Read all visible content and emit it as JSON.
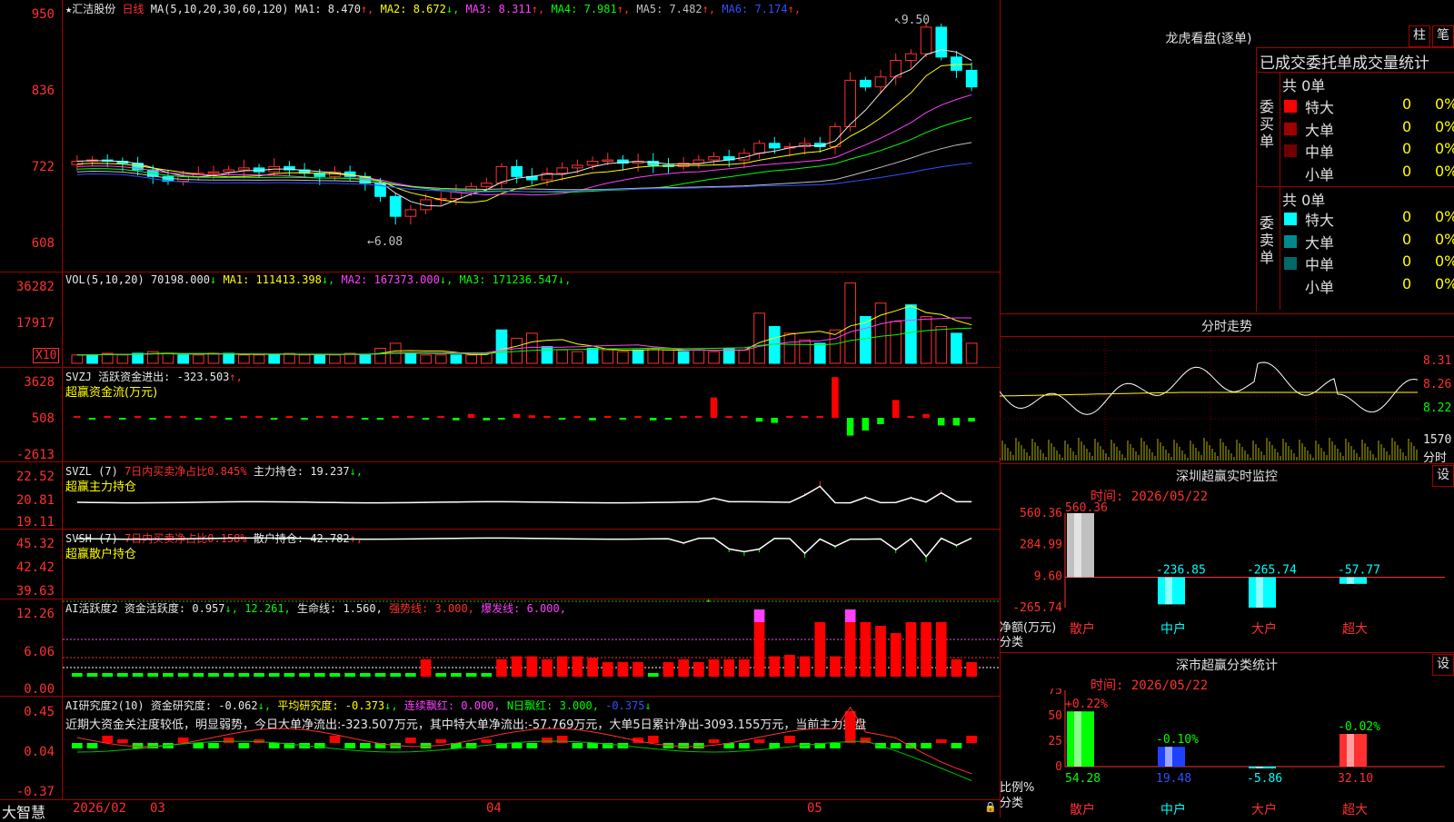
{
  "main_chart": {
    "symbol": "★汇洁股份",
    "period": "日线",
    "ma_header": "MA(5,10,20,30,60,120)",
    "ma": [
      {
        "label": "MA1:",
        "value": "8.470",
        "arrow": "↑",
        "color": "#e8e8e8"
      },
      {
        "label": "MA2:",
        "value": "8.672",
        "arrow": "↓",
        "color": "#ffff00"
      },
      {
        "label": "MA3:",
        "value": "8.311",
        "arrow": "↑",
        "color": "#ff40ff"
      },
      {
        "label": "MA4:",
        "value": "7.981",
        "arrow": "↑",
        "color": "#00ff00"
      },
      {
        "label": "MA5:",
        "value": "7.482",
        "arrow": "↑",
        "color": "#c0c0c0"
      },
      {
        "label": "MA6:",
        "value": "7.174",
        "arrow": "↑",
        "color": "#3050ff"
      }
    ],
    "y_ticks": [
      "950",
      "836",
      "722",
      "608"
    ],
    "high_annotation": "9.50",
    "low_annotation": "6.08",
    "ylim": [
      5.7,
      9.6
    ]
  },
  "volume": {
    "header": "VOL(5,10,20)",
    "value": "70198.000",
    "value_arrow": "↓",
    "ma": [
      {
        "label": "MA1:",
        "value": "111413.398",
        "arrow": "↓",
        "color": "#ffff00"
      },
      {
        "label": "MA2:",
        "value": "167373.000",
        "arrow": "↓",
        "color": "#ff40ff"
      },
      {
        "label": "MA3:",
        "value": "171236.547",
        "arrow": "↓",
        "color": "#00ff00"
      }
    ],
    "y_ticks": [
      "36282",
      "17917"
    ],
    "unit": "X10"
  },
  "svzj": {
    "header": "SVZJ",
    "label": "活跃资金进出:",
    "value": "-323.503",
    "arrow": "↑,",
    "subtitle": "超赢资金流(万元)",
    "y_ticks": [
      "3628",
      "508",
      "-2613"
    ]
  },
  "svzl": {
    "header": "SVZL (7)",
    "label1": "7日内买卖净占比0.845%",
    "label2": "主力持仓:",
    "value": "19.237",
    "arrow": "↓,",
    "subtitle": "超赢主力持仓",
    "y_ticks": [
      "22.52",
      "20.81",
      "19.11"
    ]
  },
  "svsh": {
    "header": "SVSH (7)",
    "label1": "7日内买卖净占比0.158%",
    "label2": "散户持仓:",
    "value": "42.782",
    "arrow": "↑,",
    "subtitle": "超赢散户持仓",
    "y_ticks": [
      "45.32",
      "42.42",
      "39.63"
    ]
  },
  "ai_active": {
    "header": "AI活跃度2",
    "label": "资金活跃度:",
    "value": "0.957",
    "arrow": "↓,",
    "v2": "12.261,",
    "life_label": "生命线:",
    "life_value": "1.560,",
    "strong_label": "强势线:",
    "strong_value": "3.000,",
    "burst_label": "爆发线:",
    "burst_value": "6.000,",
    "y_ticks": [
      "12.26",
      "6.06",
      "0.00"
    ]
  },
  "ai_research": {
    "header": "AI研究度2(10)",
    "label": "资金研究度:",
    "value": "-0.062",
    "arrow": "↓,",
    "avg_label": "平均研究度:",
    "avg_value": "-0.373",
    "avg_arrow": "↓,",
    "lianxu_label": "连续飘红:",
    "lianxu_value": "0.000,",
    "nday_label": "N日飘红:",
    "nday_value": "3.000,",
    "last_value": "-0.375",
    "last_arrow": "↓",
    "commentary": "近期大资金关注度较低，明显弱势，今日大单净流出:-323.507万元，其中特大单净流出:-57.769万元，大单5日累计净出-3093.155万元，当前主力控盘",
    "y_ticks": [
      "0.45",
      "0.04",
      "-0.37"
    ]
  },
  "bottom_bar": {
    "brand": "大智慧",
    "dates": [
      "2026/02",
      "03",
      "04",
      "05"
    ]
  },
  "longhu": {
    "title": "龙虎看盘(逐单)",
    "btn1": "柱",
    "btn2": "笔",
    "tabs": "已成交委托单成交量统计",
    "buy_side": "委买单",
    "sell_side": "委卖单",
    "buy_total": "共 0单",
    "sell_total": "共 0单",
    "buy_rows": [
      {
        "name": "特大",
        "count": "0",
        "pct": "0%",
        "color": "#ff0000"
      },
      {
        "name": "大单",
        "count": "0",
        "pct": "0%",
        "color": "#a00000"
      },
      {
        "name": "中单",
        "count": "0",
        "pct": "0%",
        "color": "#700000"
      },
      {
        "name": "小单",
        "count": "0",
        "pct": "0%",
        "color": ""
      }
    ],
    "sell_rows": [
      {
        "name": "特大",
        "count": "0",
        "pct": "0%",
        "color": "#00ffff"
      },
      {
        "name": "大单",
        "count": "0",
        "pct": "0%",
        "color": "#008a8a"
      },
      {
        "name": "中单",
        "count": "0",
        "pct": "0%",
        "color": "#006a6a"
      },
      {
        "name": "小单",
        "count": "0",
        "pct": "0%",
        "color": ""
      }
    ]
  },
  "intraday": {
    "title": "分时走势",
    "prices": [
      "8.31",
      "8.26",
      "8.22"
    ],
    "vol_value": "1570",
    "vol_label": "分时"
  },
  "sz_monitor": {
    "title": "深圳超赢实时监控",
    "settings": "设",
    "time": "时间: 2026/05/22",
    "y_ticks": [
      "560.36",
      "284.99",
      "9.60",
      "-265.74"
    ],
    "unit_label": "净额(万元)",
    "cat_label": "分类",
    "chart_data": {
      "type": "bar",
      "categories": [
        "散户",
        "中户",
        "大户",
        "超大"
      ],
      "values": [
        560.36,
        -236.85,
        -265.74,
        -57.77
      ],
      "value_labels": [
        "560.36",
        "-236.85",
        "-265.74",
        "-57.77"
      ],
      "ylim": [
        -265.74,
        560.36
      ]
    }
  },
  "sz_category": {
    "title": "深市超赢分类统计",
    "settings": "设",
    "time": "时间: 2026/05/22",
    "y_ticks": [
      "75",
      "50",
      "25",
      "0"
    ],
    "unit_label": "比例%",
    "cat_label": "分类",
    "chart_data": {
      "type": "bar",
      "categories": [
        "散户",
        "中户",
        "大户",
        "超大"
      ],
      "values": [
        54.28,
        19.48,
        -5.86,
        32.1
      ],
      "value_labels": [
        "54.28",
        "19.48",
        "-5.86",
        "32.10"
      ],
      "change_labels": [
        "+0.22%",
        "-0.10%",
        "",
        "-0.02%"
      ],
      "ylim": [
        0,
        75
      ]
    }
  }
}
